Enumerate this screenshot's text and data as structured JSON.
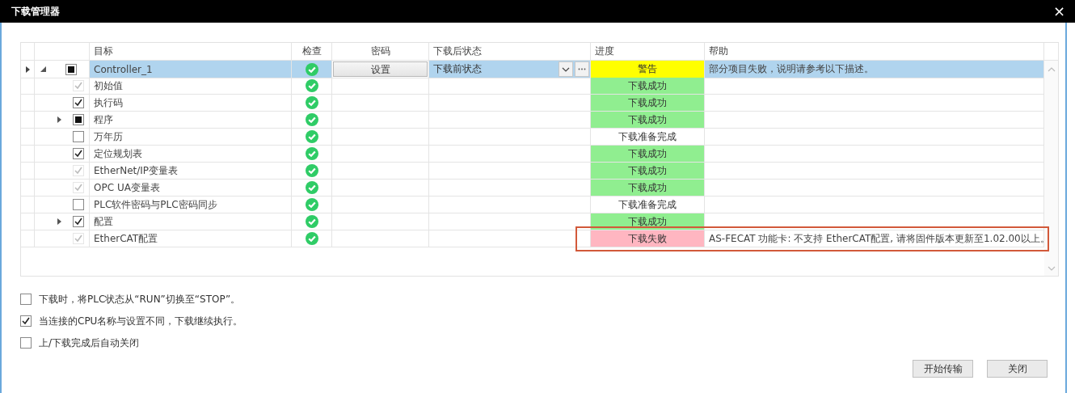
{
  "window": {
    "title": "下载管理器",
    "close": "×"
  },
  "table": {
    "columns": [
      "目标",
      "检查",
      "密码",
      "下载后状态",
      "进度",
      "帮助"
    ],
    "rows": [
      {
        "label": "Controller_1",
        "selected": true,
        "expanded": true,
        "indeterminate": true,
        "disabled": false,
        "checked_ok": true,
        "password_button": "设置",
        "post_state": "下载前状态",
        "progress": "警告",
        "color": "#ffff00",
        "help": "部分项目失败，说明请参考以下描述。",
        "highlighted": false,
        "children": [
          {
            "label": "初始值",
            "selected": false,
            "checked": true,
            "indeterminate": false,
            "disabled": true,
            "checked_ok": true,
            "progress": "下载成功",
            "color": "#90ee90",
            "highlighted": false
          },
          {
            "label": "执行码",
            "selected": false,
            "checked": true,
            "indeterminate": false,
            "disabled": false,
            "checked_ok": true,
            "progress": "下载成功",
            "color": "#90ee90",
            "highlighted": false
          },
          {
            "label": "程序",
            "selected": false,
            "expanded": false,
            "indeterminate": true,
            "disabled": false,
            "checked_ok": true,
            "progress": "下载成功",
            "color": "#90ee90",
            "highlighted": false
          },
          {
            "label": "万年历",
            "selected": false,
            "checked": false,
            "indeterminate": false,
            "disabled": false,
            "checked_ok": true,
            "progress": "下载准备完成",
            "color": "#ffffff",
            "highlighted": false
          },
          {
            "label": "定位规划表",
            "selected": false,
            "checked": true,
            "indeterminate": false,
            "disabled": false,
            "checked_ok": true,
            "progress": "下载成功",
            "color": "#90ee90",
            "highlighted": false
          },
          {
            "label": "EtherNet/IP变量表",
            "selected": false,
            "checked": true,
            "indeterminate": false,
            "disabled": true,
            "checked_ok": true,
            "progress": "下载成功",
            "color": "#90ee90",
            "highlighted": false
          },
          {
            "label": "OPC UA变量表",
            "selected": false,
            "checked": true,
            "indeterminate": false,
            "disabled": true,
            "checked_ok": true,
            "progress": "下载成功",
            "color": "#90ee90",
            "highlighted": false
          },
          {
            "label": "PLC软件密码与PLC密码同步",
            "selected": false,
            "checked": false,
            "indeterminate": false,
            "disabled": false,
            "checked_ok": true,
            "progress": "下载准备完成",
            "color": "#ffffff",
            "highlighted": false
          },
          {
            "label": "配置",
            "selected": false,
            "expanded": false,
            "checked": true,
            "indeterminate": false,
            "disabled": false,
            "checked_ok": true,
            "progress": "下载成功",
            "color": "#90ee90",
            "highlighted": false
          },
          {
            "label": "EtherCAT配置",
            "selected": false,
            "checked": true,
            "indeterminate": false,
            "disabled": true,
            "checked_ok": true,
            "progress": "下载失败",
            "color": "#ffb6c1",
            "help": "AS-FECAT 功能卡: 不支持 EtherCAT配置, 请将固件版本更新至1.02.00以上。",
            "highlighted": true
          }
        ]
      }
    ]
  },
  "options": [
    {
      "label": "下载时，将PLC状态从“RUN”切换至“STOP”。",
      "checked": false
    },
    {
      "label": "当连接的CPU名称与设置不同，下载继续执行。",
      "checked": true
    },
    {
      "label": "上/下载完成后自动关闭",
      "checked": false
    }
  ],
  "buttons": [
    "开始传输",
    "关闭"
  ]
}
